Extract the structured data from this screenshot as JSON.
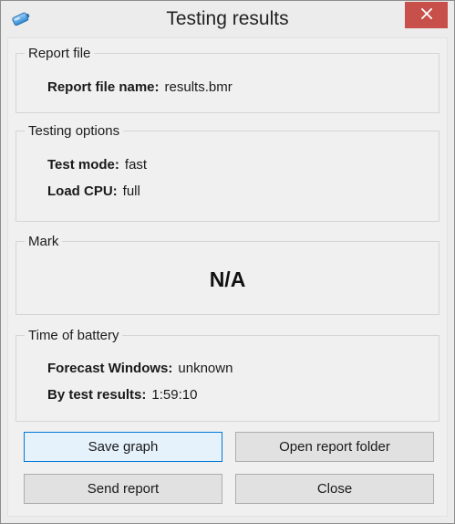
{
  "window": {
    "title": "Testing results",
    "accent_close": "#c7504b"
  },
  "report_file": {
    "legend": "Report file",
    "name_label": "Report file name:",
    "name_value": "results.bmr"
  },
  "testing_options": {
    "legend": "Testing options",
    "mode_label": "Test mode:",
    "mode_value": "fast",
    "cpu_label": "Load CPU:",
    "cpu_value": "full"
  },
  "mark": {
    "legend": "Mark",
    "value": "N/A"
  },
  "battery_time": {
    "legend": "Time of battery",
    "forecast_label": "Forecast Windows:",
    "forecast_value": "unknown",
    "test_label": "By test results:",
    "test_value": "1:59:10"
  },
  "buttons": {
    "save_graph": "Save graph",
    "open_report_folder": "Open report folder",
    "send_report": "Send report",
    "close": "Close"
  },
  "icons": {
    "app": "battery-icon",
    "close": "close-icon"
  }
}
